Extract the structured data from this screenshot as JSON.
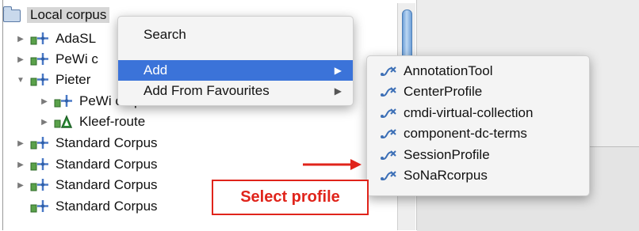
{
  "colors": {
    "highlight": "#3b73d9",
    "annotation": "#e0241b"
  },
  "tree": {
    "root": {
      "label": "Local corpus",
      "icon": "folder-open-icon"
    },
    "items": [
      {
        "label": "AdaSL",
        "expanded": false,
        "level": 1,
        "icon": "corpus-node-icon"
      },
      {
        "label": "PeWi c",
        "expanded": false,
        "level": 1,
        "icon": "corpus-node-icon"
      },
      {
        "label": "Pieter",
        "expanded": true,
        "level": 1,
        "icon": "corpus-node-icon"
      },
      {
        "label": "PeWi corpus",
        "expanded": false,
        "level": 2,
        "icon": "corpus-node-icon"
      },
      {
        "label": "Kleef-route",
        "expanded": false,
        "level": 2,
        "icon": "route-node-icon"
      },
      {
        "label": "Standard Corpus",
        "expanded": false,
        "level": 1,
        "icon": "corpus-node-icon"
      },
      {
        "label": "Standard Corpus",
        "expanded": false,
        "level": 1,
        "icon": "corpus-node-icon"
      },
      {
        "label": "Standard Corpus",
        "expanded": false,
        "level": 1,
        "icon": "corpus-node-icon"
      },
      {
        "label": "Standard Corpus",
        "expanded": null,
        "level": 1,
        "icon": "corpus-node-icon"
      }
    ]
  },
  "context_menu": {
    "items": [
      {
        "label": "Search",
        "submenu": false,
        "highlighted": false
      },
      {
        "label": "Add",
        "submenu": true,
        "highlighted": true
      },
      {
        "label": "Add From Favourites",
        "submenu": true,
        "highlighted": false
      }
    ]
  },
  "submenu": {
    "icon": "profile-icon",
    "items": [
      {
        "label": "AnnotationTool"
      },
      {
        "label": "CenterProfile"
      },
      {
        "label": "cmdi-virtual-collection"
      },
      {
        "label": "component-dc-terms"
      },
      {
        "label": "SessionProfile"
      },
      {
        "label": "SoNaRcorpus"
      }
    ]
  },
  "annotation": {
    "label": "Select profile"
  }
}
